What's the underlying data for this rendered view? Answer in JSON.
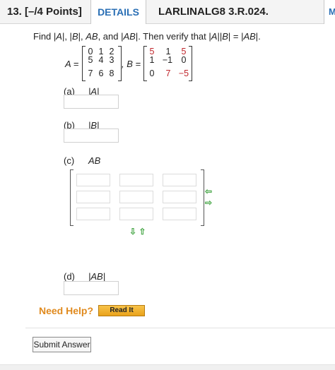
{
  "header": {
    "question_number": "13.  [–/4 Points]",
    "details_tab": "DETAILS",
    "course_code": "LARLINALG8 3.R.024.",
    "corner_tab": "M"
  },
  "problem": {
    "prompt_parts": [
      "Find |",
      "A",
      "|,  |",
      "B",
      "|,  ",
      "AB",
      ",  and |",
      "AB",
      "|.  Then verify that |",
      "A",
      "||",
      "B",
      "| = |",
      "AB",
      "|."
    ],
    "matrix_a": {
      "label": "A =",
      "rows": [
        [
          "0",
          "1",
          "2"
        ],
        [
          "5",
          "4",
          "3"
        ],
        [
          "7",
          "6",
          "8"
        ]
      ]
    },
    "matrix_b": {
      "label": ", B =",
      "rows": [
        [
          "5",
          "1",
          "5"
        ],
        [
          "1",
          "−1",
          "0"
        ],
        [
          "0",
          "7",
          "−5"
        ]
      ],
      "red_cells": [
        [
          0,
          0
        ],
        [
          0,
          2
        ],
        [
          2,
          1
        ],
        [
          2,
          2
        ]
      ]
    }
  },
  "parts": [
    {
      "label": "(a)",
      "expr": "|A|"
    },
    {
      "label": "(b)",
      "expr": "|B|"
    },
    {
      "label": "(c)",
      "expr": "AB"
    },
    {
      "label": "(d)",
      "expr": "|AB|"
    }
  ],
  "ab_matrix": {
    "side_arrows": [
      "⇦",
      "⇨"
    ],
    "bottom_arrows": "⇩ ⇧"
  },
  "help": {
    "label": "Need Help?",
    "read_it": "Read It"
  },
  "submit_label": "Submit Answer",
  "colors": {
    "accent_blue": "#2a6fb5",
    "red_entry": "#c0272d",
    "help_orange": "#e08a1e",
    "arrow_green": "#4aa84a"
  }
}
